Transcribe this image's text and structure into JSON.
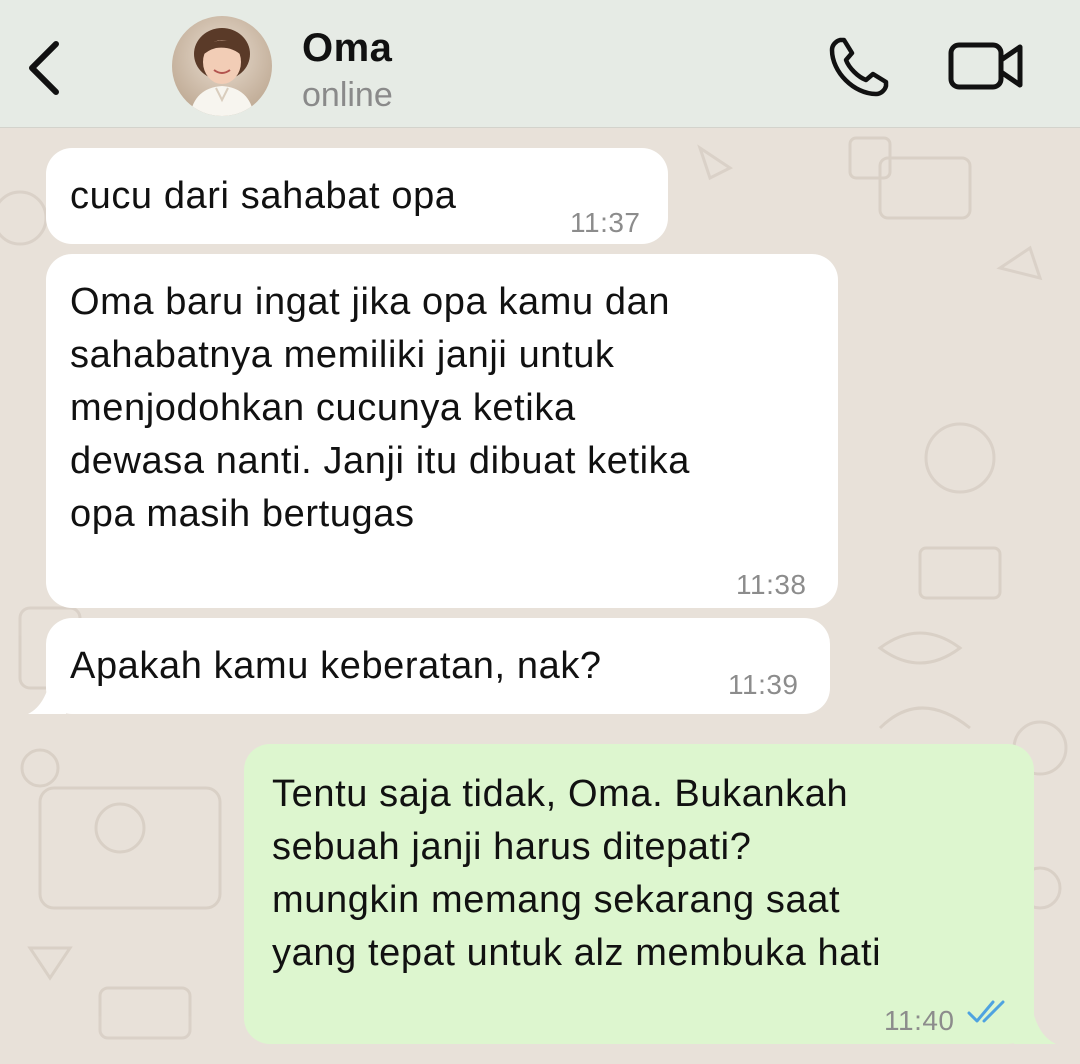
{
  "header": {
    "back_icon": "chevron-left-icon",
    "contact_name": "Oma",
    "status": "online",
    "call_icon": "phone-icon",
    "video_icon": "video-camera-icon"
  },
  "colors": {
    "header_bg": "#e6ebe5",
    "chat_bg": "#e8e1d9",
    "incoming_bubble": "#ffffff",
    "outgoing_bubble": "#ddf6cf",
    "read_ticks": "#4fa3e0"
  },
  "messages": [
    {
      "direction": "incoming",
      "lines": [
        "cucu dari sahabat opa"
      ],
      "time": "11:37"
    },
    {
      "direction": "incoming",
      "lines": [
        "Oma baru ingat jika opa kamu dan",
        "sahabatnya memiliki janji untuk",
        "menjodohkan cucunya ketika",
        "dewasa nanti. Janji itu dibuat ketika",
        "opa masih bertugas"
      ],
      "time": "11:38"
    },
    {
      "direction": "incoming",
      "lines": [
        "Apakah kamu keberatan, nak?"
      ],
      "time": "11:39"
    },
    {
      "direction": "outgoing",
      "lines": [
        "Tentu saja tidak, Oma. Bukankah",
        "sebuah janji harus ditepati?",
        "mungkin memang sekarang saat",
        "yang tepat untuk alz membuka hati"
      ],
      "time": "11:40",
      "status_icon": "double-check-read-icon"
    }
  ]
}
